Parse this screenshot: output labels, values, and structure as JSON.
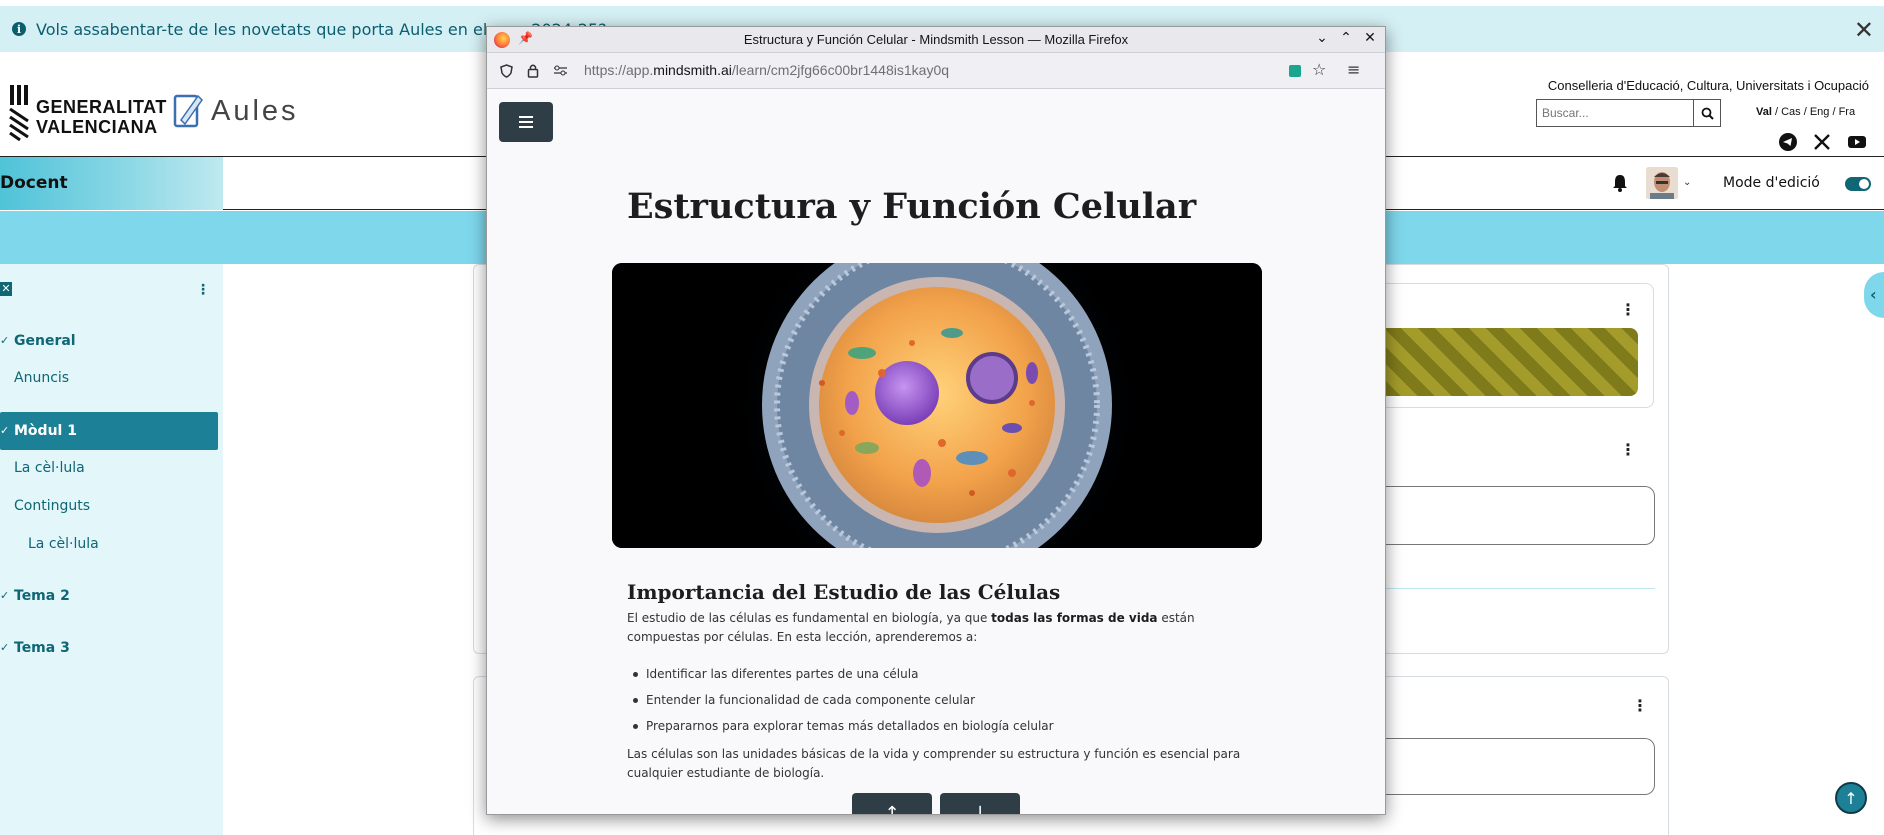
{
  "notice": {
    "text": "Vols assabentar-te de les novetats que porta Aules en el curs 2024-25?",
    "close": "✕"
  },
  "brand": {
    "gva_line1": "GENERALITAT",
    "gva_line2": "VALENCIANA",
    "aules": "Aules",
    "conselleria": "Conselleria d'Educació, Cultura, Universitats i Ocupació",
    "search_placeholder": "Buscar...",
    "langs": [
      "Val",
      "Cas",
      "Eng",
      "Fra"
    ]
  },
  "navbar": {
    "tab": "Docent",
    "edit_mode": "Mode d'edició"
  },
  "drawer": {
    "items": [
      {
        "label": "General",
        "section": true
      },
      {
        "label": "Anuncis",
        "section": false
      },
      {
        "label": "Mòdul 1",
        "section": true,
        "active": true
      },
      {
        "label": "La cèl·lula",
        "section": false
      },
      {
        "label": "Continguts",
        "section": false
      },
      {
        "label": "La cèl·lula",
        "section": false,
        "indent": true
      },
      {
        "label": "Tema 2",
        "section": true
      },
      {
        "label": "Tema 3",
        "section": true
      }
    ]
  },
  "firefox": {
    "window_title": "Estructura y Función Celular - Mindsmith Lesson — Mozilla Firefox",
    "url_prefix": "https://app.",
    "url_domain": "mindsmith.ai",
    "url_path": "/learn/cm2jfg66c00br1448is1kay0q"
  },
  "lesson": {
    "title": "Estructura y Función Celular",
    "section_title": "Importancia del Estudio de las Células",
    "intro_before": "El estudio de las células es fundamental en biología, ya que ",
    "intro_bold": "todas las formas de vida",
    "intro_after": " están compuestas por células. En esta lección, aprenderemos a:",
    "bullets": [
      "Identificar las diferentes partes de una célula",
      "Entender la funcionalidad de cada componente celular",
      "Prepararnos para explorar temas más detallados en biología celular"
    ],
    "closing": "Las células son las unidades básicas de la vida y comprender su estructura y función es esencial para cualquier estudiante de biología.",
    "prev_arrow": "↑",
    "next_arrow": "↓"
  },
  "icons": {
    "menu": "hamburger-icon",
    "bell": "bell-icon",
    "search": "search-icon"
  },
  "colors": {
    "accent": "#0f6674",
    "active_nav": "#1c8197",
    "band": "#7fd7ec",
    "lesson_button": "#2f3e46"
  }
}
